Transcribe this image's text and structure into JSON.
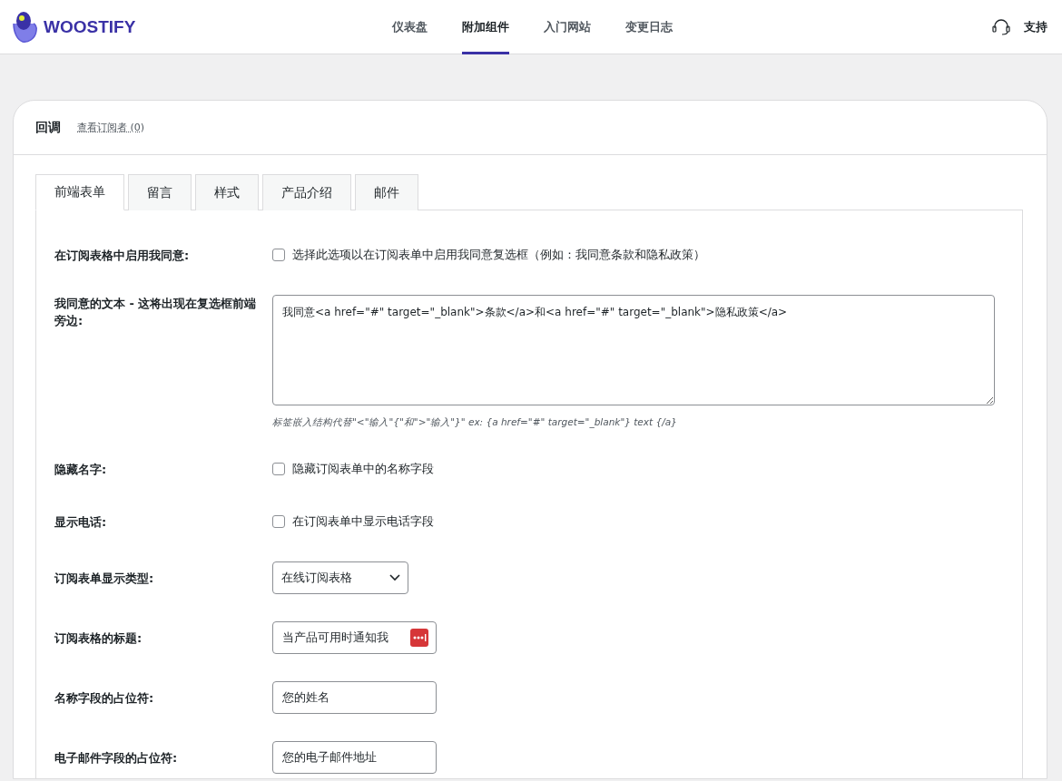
{
  "header": {
    "brand": "WOOSTIFY",
    "nav": [
      {
        "label": "仪表盘",
        "selected": false
      },
      {
        "label": "附加组件",
        "selected": true
      },
      {
        "label": "入门网站",
        "selected": false
      },
      {
        "label": "变更日志",
        "selected": false
      }
    ],
    "support": "支持"
  },
  "card": {
    "title": "回调",
    "link": "查看订阅者 (0)"
  },
  "tabs": [
    {
      "label": "前端表单",
      "selected": true
    },
    {
      "label": "留言",
      "selected": false
    },
    {
      "label": "样式",
      "selected": false
    },
    {
      "label": "产品介绍",
      "selected": false
    },
    {
      "label": "邮件",
      "selected": false
    }
  ],
  "settings": [
    {
      "kind": "checkbox",
      "label": "在订阅表格中启用我同意:",
      "text": "选择此选项以在订阅表单中启用我同意复选框（例如：我同意条款和隐私政策）",
      "checked": false
    },
    {
      "kind": "textarea",
      "label": "我同意的文本 - 这将出现在复选框前端旁边:",
      "value": "我同意<a href=\"#\" target=\"_blank\">条款</a>和<a href=\"#\" target=\"_blank\">隐私政策</a>",
      "hint": "标签嵌入结构代替\"<\"输入\"{\"和\">\"输入\"}\" ex: {a href=\"#\" target=\"_blank\"} text {/a}"
    },
    {
      "kind": "checkbox",
      "label": "隐藏名字:",
      "text": "隐藏订阅表单中的名称字段",
      "checked": false
    },
    {
      "kind": "checkbox",
      "label": "显示电话:",
      "text": "在订阅表单中显示电话字段",
      "checked": false
    },
    {
      "kind": "select",
      "label": "订阅表单显示类型:",
      "value": "在线订阅表格"
    },
    {
      "kind": "text",
      "label": "订阅表格的标题:",
      "value": "当产品可用时通知我",
      "badge": true
    },
    {
      "kind": "text",
      "label": "名称字段的占位符:",
      "value": "您的姓名"
    },
    {
      "kind": "text",
      "label": "电子邮件字段的占位符:",
      "value": "您的电子邮件地址"
    }
  ]
}
